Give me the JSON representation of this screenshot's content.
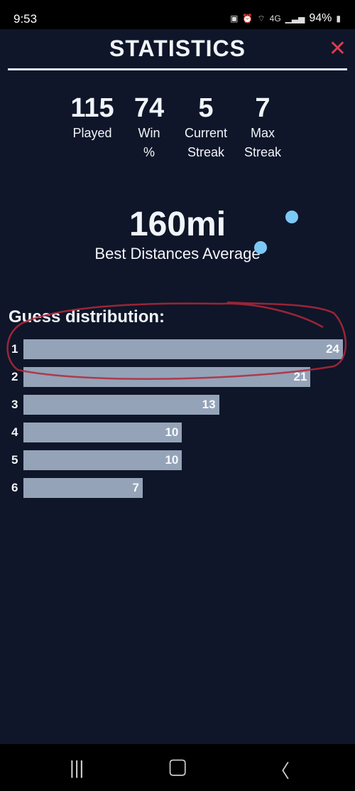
{
  "status_bar": {
    "time": "9:53",
    "battery": "94%",
    "network": "4G"
  },
  "header": {
    "title": "STATISTICS",
    "close_icon": "close-icon"
  },
  "stats": [
    {
      "value": "115",
      "label": "Played"
    },
    {
      "value": "74",
      "label": "Win %"
    },
    {
      "value": "5",
      "label": "Current Streak"
    },
    {
      "value": "7",
      "label": "Max Streak"
    }
  ],
  "average": {
    "value": "160mi",
    "label": "Best Distances Average"
  },
  "distribution": {
    "title": "Guess distribution:",
    "rows": [
      {
        "guess": "1",
        "count": 24
      },
      {
        "guess": "2",
        "count": 21
      },
      {
        "guess": "3",
        "count": 13
      },
      {
        "guess": "4",
        "count": 10
      },
      {
        "guess": "5",
        "count": 10
      },
      {
        "guess": "6",
        "count": 7
      }
    ]
  },
  "colors": {
    "background": "#0f1629",
    "bar": "#94a3b8",
    "close": "#e03a4e",
    "annotation": "#b3283a",
    "dots": "#7cc8f5"
  }
}
